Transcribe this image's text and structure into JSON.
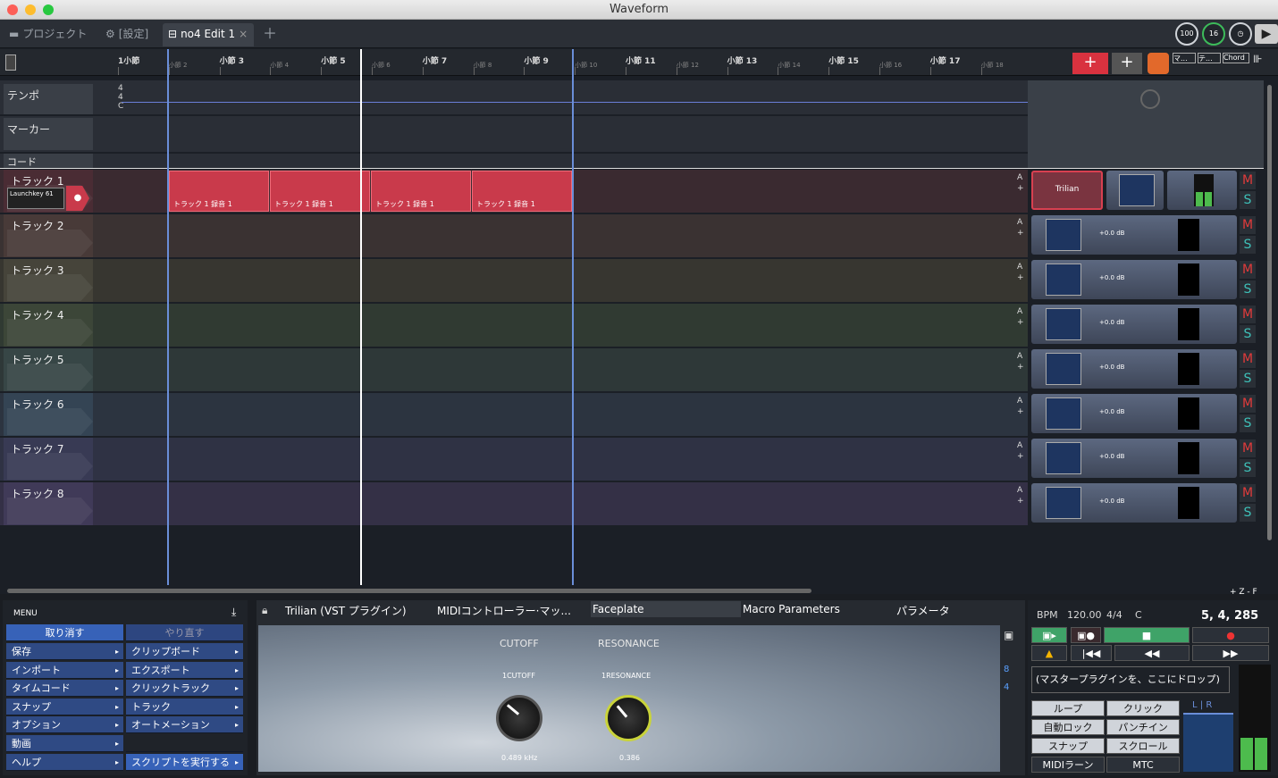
{
  "window": {
    "title": "Waveform"
  },
  "tabs": {
    "project": "プロジェクト",
    "settings": "[設定]",
    "edit": "no4 Edit 1"
  },
  "top_right": {
    "c1": "100",
    "c2": "16"
  },
  "ruler": {
    "bars": [
      "1小節",
      "小節 2",
      "小節 3",
      "小節 4",
      "小節 5",
      "小節 6",
      "小節 7",
      "小節 8",
      "小節 9",
      "小節 10",
      "小節 11",
      "小節 12",
      "小節 13",
      "小節 14",
      "小節 15",
      "小節 16",
      "小節 17",
      "小節 18"
    ],
    "right_buttons": [
      "マ...",
      "テ...",
      "Chord"
    ]
  },
  "lanes": {
    "tempo": "テンポ",
    "tempo_sig": [
      "4",
      "4",
      "C"
    ],
    "marker": "マーカー",
    "chord": "コード"
  },
  "tracks": [
    {
      "name": "トラック 1",
      "input": "Launchkey 61",
      "plugin": "Trilian"
    },
    {
      "name": "トラック 2",
      "gain": "+0.0 dB"
    },
    {
      "name": "トラック 3",
      "gain": "+0.0 dB"
    },
    {
      "name": "トラック 4",
      "gain": "+0.0 dB"
    },
    {
      "name": "トラック 5",
      "gain": "+0.0 dB"
    },
    {
      "name": "トラック 6",
      "gain": "+0.0 dB"
    },
    {
      "name": "トラック 7",
      "gain": "+0.0 dB"
    },
    {
      "name": "トラック 8",
      "gain": "+0.0 dB"
    }
  ],
  "clip_label": "トラック 1 録音 1",
  "mixer_buttons": {
    "mute": "M",
    "solo": "S",
    "auto": "A"
  },
  "zoom": {
    "label": "+ Z - F"
  },
  "menu": {
    "title": "MENU",
    "undo": "取り消す",
    "redo": "やり直す",
    "items_left": [
      "保存",
      "インポート",
      "タイムコード",
      "スナップ",
      "オプション",
      "動画",
      "ヘルプ"
    ],
    "items_right": [
      "クリップボード",
      "エクスポート",
      "クリックトラック",
      "トラック",
      "オートメーション",
      "",
      "スクリプトを実行する"
    ]
  },
  "plugin_panel": {
    "tabs": [
      "Trilian (VST プラグイン)",
      "MIDIコントローラー·マッ...",
      "Faceplate",
      "Macro Parameters",
      "パラメータ"
    ],
    "knobs": [
      {
        "title": "CUTOFF",
        "sub": "1CUTOFF",
        "value": "0.489 kHz"
      },
      {
        "title": "RESONANCE",
        "sub": "1RESONANCE",
        "value": "0.386"
      }
    ],
    "side_numbers": [
      "8",
      "4"
    ]
  },
  "transport": {
    "bpm_label": "BPM",
    "bpm": "120.00",
    "sig": "4/4",
    "key": "C",
    "position": "5, 4, 285",
    "drop": "(マスタープラグインを、ここにドロップ)",
    "buttons": [
      "ループ",
      "クリック",
      "自動ロック",
      "パンチイン",
      "スナップ",
      "スクロール",
      "MIDIラーン",
      "MTC"
    ],
    "lr": [
      "L",
      "R"
    ]
  }
}
